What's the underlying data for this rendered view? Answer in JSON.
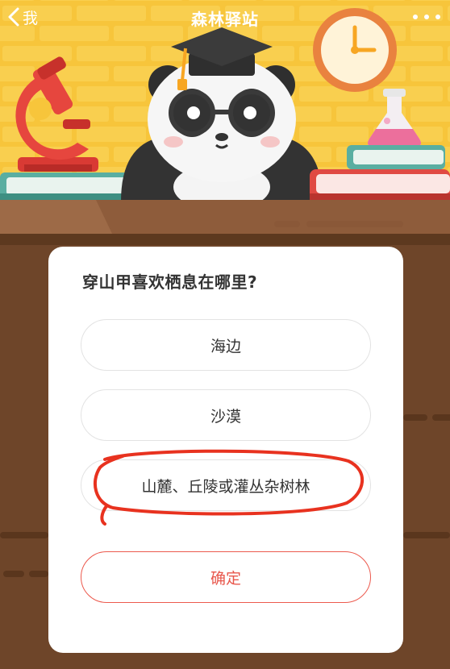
{
  "nav": {
    "back_label": "我",
    "title": "森林驿站"
  },
  "question": {
    "text": "穿山甲喜欢栖息在哪里?",
    "options": [
      {
        "label": "海边"
      },
      {
        "label": "沙漠"
      },
      {
        "label": "山麓、丘陵或灌丛杂树林",
        "annotated": true
      }
    ],
    "confirm_label": "确定"
  },
  "icons": {
    "back": "chevron-left-icon",
    "more": "more-dots-icon"
  },
  "colors": {
    "wall": "#f7c53b",
    "desk": "#6e4529",
    "accent": "#e8574c",
    "annotation": "#e8321f"
  }
}
